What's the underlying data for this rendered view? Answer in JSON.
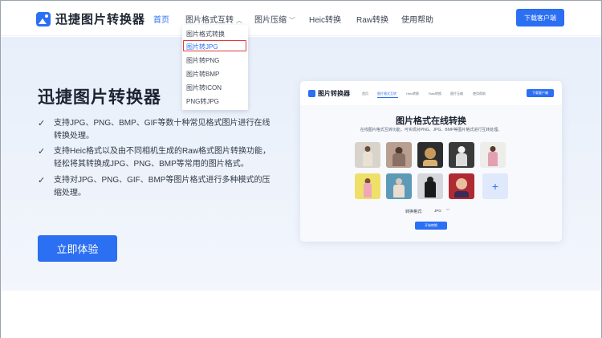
{
  "app": {
    "logo_text": "迅捷图片转换器"
  },
  "nav": {
    "items": [
      {
        "label": "首页"
      },
      {
        "label": "图片格式互转"
      },
      {
        "label": "图片压缩"
      },
      {
        "label": "Heic转换"
      },
      {
        "label": "Raw转换"
      },
      {
        "label": "使用帮助"
      }
    ],
    "download_label": "下载客户端"
  },
  "dropdown": {
    "items": [
      {
        "label": "图片格式转换"
      },
      {
        "label": "图片转JPG"
      },
      {
        "label": "图片转PNG"
      },
      {
        "label": "图片转BMP"
      },
      {
        "label": "图片转ICON"
      },
      {
        "label": "PNG转JPG"
      }
    ],
    "highlight_color": "#e23a3a"
  },
  "hero": {
    "title": "迅捷图片转换器",
    "features": [
      {
        "text": "支持JPG、PNG、BMP、GIF等数十种常见格式图片进行在线转换处理。"
      },
      {
        "text": "支持Heic格式以及由不同相机生成的Raw格式图片转换功能，轻松将其转换成JPG、PNG、BMP等常用的图片格式。"
      },
      {
        "text": "支持对JPG、PNG、GIF、BMP等图片格式进行多种模式的压缩处理。"
      }
    ],
    "cta_label": "立即体验"
  },
  "preview": {
    "logo_text": "图片转换器",
    "menu": [
      "首页",
      "图片格式互转",
      "Heic转换",
      "Raw转换",
      "图片压缩",
      "使用帮助"
    ],
    "download_label": "下载客户端",
    "title": "图片格式在线转换",
    "subtitle": "在线图片格式互转功能，可实现对PNG、JPG、BMP等图片格式进行互转处理。",
    "format_label": "转换格式:",
    "format_value": "JPG",
    "start_label": "开始转换"
  },
  "colors": {
    "accent": "#2b6ff3",
    "hero_bg": "#e8effa",
    "text_dark": "#1c2230"
  }
}
